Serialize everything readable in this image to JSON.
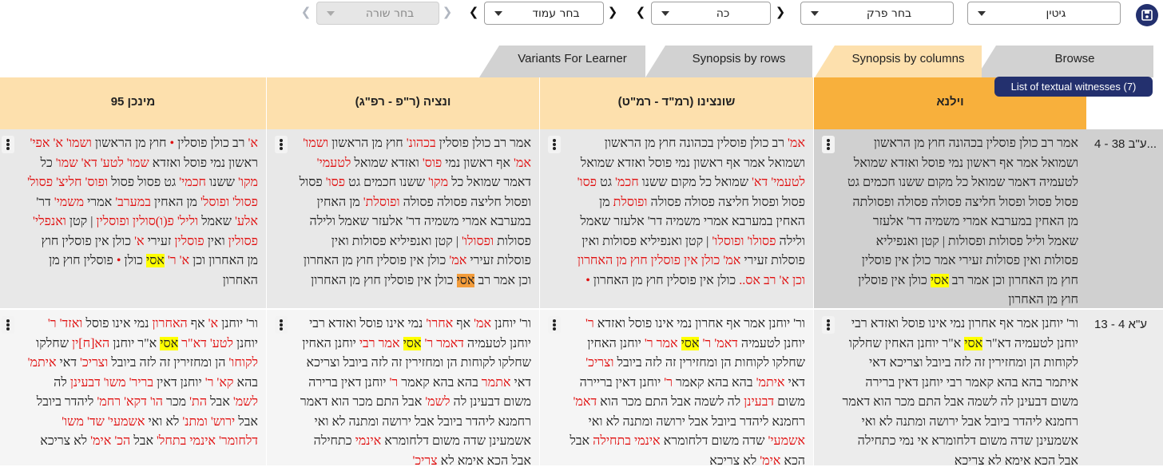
{
  "toolbar": {
    "tractate_select": "גיטין",
    "chapter_select": "בחר פרק",
    "page_select": "כה",
    "column_select": "בחר עמוד",
    "row_select": "בחר שורה",
    "nav_arrow": "❯",
    "nav_arrow_left": "❮"
  },
  "tabs": [
    "Browse",
    "Synopsis by columns",
    "Synopsis by rows",
    "Variants For Learner"
  ],
  "witness_button": "List of textual witnesses (7)",
  "columns": [
    "וילנא",
    "שונצינו (רמ\"ד - רמ\"ט)",
    "ונציה (ר\"פ - רפ\"ג)",
    "מינכן 95"
  ],
  "colors": {
    "primary_header": "#f8b03c",
    "header": "#fde0ad",
    "variant_text": "#e01010",
    "highlight": "#ffff00",
    "navy": "#23306e"
  },
  "rows": [
    {
      "label": "ע\"ב 38 - 4...",
      "cells": [
        [
          {
            "t": "אמר רב כולן פוסלין בכהונה חוץ מן הראשון ושמואל אמר אף ראשון נמי פוסל ואזדא שמואל לטעמיה דאמר שמואל כל מקום ששנו חכמים גט פסול פסול ופסול חליצה פסולה פסולה ופסולתה מן האחין במערבא אמרי משמיה דר' אלעזר שאמל וליל פסולות ופסולות | קטן ואנפיליא פסולות ואין פסולות זעירי אמר כולן אין פוסלין חוץ מן האחרון וכן אמר רב "
          },
          {
            "t": "אסי",
            "c": "hl"
          },
          {
            "t": " כולן אין פוסלין חוץ מן האחרון"
          }
        ],
        [
          {
            "t": "אמ'",
            "c": "r"
          },
          {
            "t": " רב כולן פוסלין בכהונה חוץ מן הראשון ושמואל אמר אף ראשון נמי פוסל ואזדא שמואל "
          },
          {
            "t": "לטעמי' דא'",
            "c": "r"
          },
          {
            "t": " שמואל כל מקום ששנו "
          },
          {
            "t": "חכמ'",
            "c": "r"
          },
          {
            "t": " גט "
          },
          {
            "t": "פסו'",
            "c": "r"
          },
          {
            "t": " פסול ופסול חליצה פסולה פסולה "
          },
          {
            "t": "ופוסלת",
            "c": "r"
          },
          {
            "t": " מן האחין במערבא אמרי משמיה דר' אלעזר שאמל ולילה "
          },
          {
            "t": "פסולו' ופוסלו'",
            "c": "r"
          },
          {
            "t": " | קטן ואנפיליא פסולות ואין פוסלות זעירי "
          },
          {
            "t": "אמ' כולן אין פוסלין חוץ מן האחרון",
            "c": "r"
          },
          {
            "t": " "
          },
          {
            "t": "וכן א' רב אס..",
            "c": "r"
          },
          {
            "t": " כולן אין פוסלין חוץ מן האחרון "
          },
          {
            "t": "•",
            "c": "r"
          }
        ],
        [
          {
            "t": "אמר רב כולן פוסלין "
          },
          {
            "t": "בכהונ'",
            "c": "r"
          },
          {
            "t": " חוץ מן הראשון "
          },
          {
            "t": "ושמו' אמ'",
            "c": "r"
          },
          {
            "t": " אף ראשון נמי "
          },
          {
            "t": "פוס'",
            "c": "r"
          },
          {
            "t": " ואזדא שמואל "
          },
          {
            "t": "לטעמי'",
            "c": "r"
          },
          {
            "t": " דאמר שמואל כל "
          },
          {
            "t": "מקו'",
            "c": "r"
          },
          {
            "t": " ששנו חכמים גט "
          },
          {
            "t": "פסו'",
            "c": "r"
          },
          {
            "t": " פסול ופסול חליצה פסולה פסולה "
          },
          {
            "t": "ופוסלת'",
            "c": "r"
          },
          {
            "t": " מן האחין במערבא אמרי משמיה דר' אלעזר שאמל ולילה פסולות "
          },
          {
            "t": "ופסולו'",
            "c": "r"
          },
          {
            "t": " | קטן ואנפיליא פסולות ואין פוסלות זעירי "
          },
          {
            "t": "אמ'",
            "c": "r"
          },
          {
            "t": " כולן אין פוסלין חוץ מן האחרון וכן אמר רב "
          },
          {
            "t": "אסי",
            "c": "ho"
          },
          {
            "t": " כולן אין פוסלין חוץ מן האחרון"
          }
        ],
        [
          {
            "t": "א'",
            "c": "r"
          },
          {
            "t": " רב כולן פוסלין "
          },
          {
            "t": "•",
            "c": "r"
          },
          {
            "t": " חוץ מן הראשון "
          },
          {
            "t": "ושמו' א' אפי'",
            "c": "r"
          },
          {
            "t": " ראשון נמי פוסל ואזדא "
          },
          {
            "t": "שמו' לטע' דא' שמו'",
            "c": "r"
          },
          {
            "t": " כל "
          },
          {
            "t": "מקו'",
            "c": "r"
          },
          {
            "t": " ששנו "
          },
          {
            "t": "חכמי'",
            "c": "r"
          },
          {
            "t": " גט פסול פסול "
          },
          {
            "t": "ופוס' חליצ' פסול' פסול' ופוסל'",
            "c": "r"
          },
          {
            "t": " מן האחין "
          },
          {
            "t": "במערב'",
            "c": "r"
          },
          {
            "t": " אמרי "
          },
          {
            "t": "משמי'",
            "c": "r"
          },
          {
            "t": " דר' "
          },
          {
            "t": "אלע'",
            "c": "r"
          },
          {
            "t": " שאמל "
          },
          {
            "t": "וליל' פ(ו)סולין ופוסלין",
            "c": "r"
          },
          {
            "t": " | קטן "
          },
          {
            "t": "ואנפלי' פסולין",
            "c": "r"
          },
          {
            "t": " ואין "
          },
          {
            "t": "פוסלין",
            "c": "r"
          },
          {
            "t": " זעירי "
          },
          {
            "t": "א'",
            "c": "r"
          },
          {
            "t": " כולן אין פוסלין חוץ מן האחרון וכן "
          },
          {
            "t": "א' ר'",
            "c": "r"
          },
          {
            "t": " "
          },
          {
            "t": "אסי",
            "c": "hl"
          },
          {
            "t": " כולן "
          },
          {
            "t": "•",
            "c": "r"
          },
          {
            "t": " פוסלין חוץ מן האחרון"
          }
        ]
      ]
    },
    {
      "label": "ע\"א 4 - 13",
      "cells": [
        [
          {
            "t": "ור' יוחנן אמר אף אחרון נמי אינו פוסל ואזדא רבי יוחנן לטעמיה דא\"ר "
          },
          {
            "t": "אסי",
            "c": "hl"
          },
          {
            "t": " א\"ר יוחנן האחין שחלקו לקוחות הן ומחזירין זה לזה ביובל וצריכא דאי איתמר בהא בהא קאמר רבי יוחנן דאין ברירה משום דבעינן לה לשמה אבל התם מכר הוא דאמר רחמנא ליהדר ביובל אבל ירושה ומתנה לא ואי אשמעינן שדה משום דלחומרא אי נמי כתחילה אבל הכא אימא לא צריכא"
          }
        ],
        [
          {
            "t": "ור' יוחנן אמר אף אחרון נמי אינו פוסל ואזדא "
          },
          {
            "t": "ר'",
            "c": "r"
          },
          {
            "t": " יוחנן לטעמיה "
          },
          {
            "t": "דאמ' ר'",
            "c": "r"
          },
          {
            "t": " "
          },
          {
            "t": "אסי",
            "c": "hl"
          },
          {
            "t": " "
          },
          {
            "t": "אמר ר'",
            "c": "r"
          },
          {
            "t": " יוחנן האחין שחלקו לקוחות הן ומחזירין זה לזה ביובל "
          },
          {
            "t": "וצריכ'",
            "c": "r"
          },
          {
            "t": " דאי "
          },
          {
            "t": "איתמ'",
            "c": "r"
          },
          {
            "t": " בהא בהא קאמר "
          },
          {
            "t": "ר'",
            "c": "r"
          },
          {
            "t": " יוחנן דאין בריירה משום "
          },
          {
            "t": "דבעינן",
            "c": "r"
          },
          {
            "t": " לה לשמה אבל התם מכר הוא "
          },
          {
            "t": "דאמ'",
            "c": "r"
          },
          {
            "t": " רחמנא ליהדר ביובל אבל ירושה ומתנה לא ואי "
          },
          {
            "t": "אשמעי'",
            "c": "r"
          },
          {
            "t": " שדה משום דלחומרא "
          },
          {
            "t": "אינמי בתחילה",
            "c": "r"
          },
          {
            "t": " אבל הכא "
          },
          {
            "t": "אימ'",
            "c": "r"
          },
          {
            "t": " לא צריכא"
          }
        ],
        [
          {
            "t": "ור' יוחנן "
          },
          {
            "t": "אמ'",
            "c": "r"
          },
          {
            "t": " אף "
          },
          {
            "t": "אחרו'",
            "c": "r"
          },
          {
            "t": " נמי אינו פוסל ואזדא רבי יוחנן לטעמיה "
          },
          {
            "t": "דאמר ר'",
            "c": "r"
          },
          {
            "t": " "
          },
          {
            "t": "אסי",
            "c": "hl"
          },
          {
            "t": " "
          },
          {
            "t": "אמר רבי",
            "c": "r"
          },
          {
            "t": " יוחנן האחין שחלקו לקוחות הן ומחזירין זה לזה ביובל וצריכא דאי "
          },
          {
            "t": "אתמר",
            "c": "r"
          },
          {
            "t": " בהא בהא קאמר "
          },
          {
            "t": "ר'",
            "c": "r"
          },
          {
            "t": " יוחנן דאין ברירה משום דבעינן לה "
          },
          {
            "t": "לשמ'",
            "c": "r"
          },
          {
            "t": " אבל התם מכר הוא דאמר רחמנא ליהדר ביובל אבל ירושה ומתנה לא ואי אשמעינן שדה משום דלחומרא "
          },
          {
            "t": "אינמי",
            "c": "r"
          },
          {
            "t": " כתחילה אבל הכא אימא לא "
          },
          {
            "t": "צריכ'",
            "c": "r"
          }
        ],
        [
          {
            "t": "ור' יוחנן "
          },
          {
            "t": "א'",
            "c": "r"
          },
          {
            "t": " אף "
          },
          {
            "t": "האחרון",
            "c": "r"
          },
          {
            "t": " נמי אינו פוסל "
          },
          {
            "t": "ואזד' ר'",
            "c": "r"
          },
          {
            "t": " יוחנן "
          },
          {
            "t": "לטע' דא\"ר",
            "c": "r"
          },
          {
            "t": " "
          },
          {
            "t": "אסי",
            "c": "hl"
          },
          {
            "t": " א\"ר יוחנן "
          },
          {
            "t": "הא[ח]ין",
            "c": "r"
          },
          {
            "t": " שחלקו "
          },
          {
            "t": "לקוחו'",
            "c": "r"
          },
          {
            "t": " הן ומחזירין זה לזה ביובל "
          },
          {
            "t": "וצריכ'",
            "c": "r"
          },
          {
            "t": " דאי "
          },
          {
            "t": "איתמ'",
            "c": "r"
          },
          {
            "t": " בהא "
          },
          {
            "t": "קא' ר'",
            "c": "r"
          },
          {
            "t": " יוחנן דאין "
          },
          {
            "t": "בריר' משו' דבעינן",
            "c": "r"
          },
          {
            "t": " לה "
          },
          {
            "t": "לשמ'",
            "c": "r"
          },
          {
            "t": " אבל "
          },
          {
            "t": "הת'",
            "c": "r"
          },
          {
            "t": " מכר "
          },
          {
            "t": "הו' דקא' רחמ'",
            "c": "r"
          },
          {
            "t": " ליהדר ביובל אבל "
          },
          {
            "t": "ירוש' ומתנ'",
            "c": "r"
          },
          {
            "t": " לא ואי "
          },
          {
            "t": "אשמעי' שד' משו' דלחומר' אינמי בתחל'",
            "c": "r"
          },
          {
            "t": " אבל "
          },
          {
            "t": "הכ' אימ'",
            "c": "r"
          },
          {
            "t": " לא צריכא"
          }
        ]
      ]
    }
  ]
}
